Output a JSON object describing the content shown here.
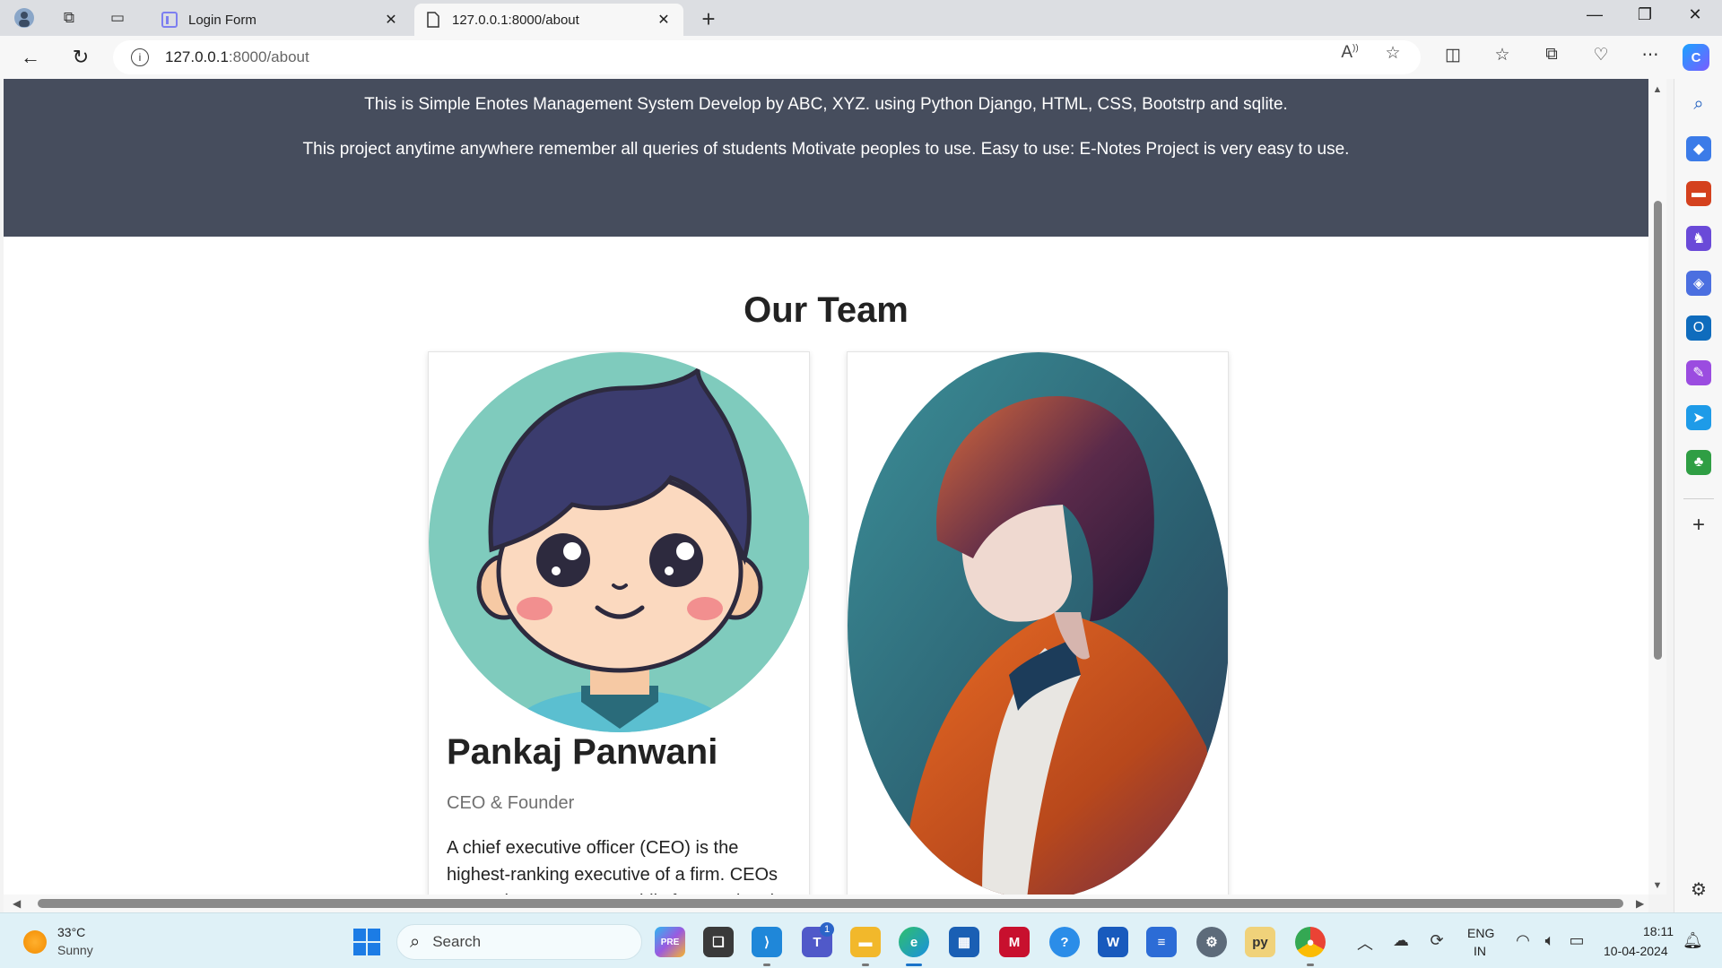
{
  "browser": {
    "tabs": [
      {
        "title": "Login Form",
        "active": false
      },
      {
        "title": "127.0.0.1:8000/about",
        "active": true
      }
    ],
    "url_host": "127.0.0.1",
    "url_path": ":8000/about"
  },
  "page": {
    "hero_line1": "This is Simple Enotes Management System Develop by ABC, XYZ. using Python Django, HTML, CSS, Bootstrp and sqlite.",
    "hero_line2": "This project anytime anywhere remember all queries of students Motivate peoples to use. Easy to use: E-Notes Project is very easy to use.",
    "team_title": "Our Team",
    "members": [
      {
        "name": "Pankaj Panwani",
        "role": "CEO & Founder",
        "bio": "A chief executive officer (CEO) is the highest-ranking executive of a firm. CEOs act as the company's public face and make"
      }
    ]
  },
  "taskbar": {
    "temperature": "33°C",
    "weather": "Sunny",
    "search_placeholder": "Search",
    "language_line1": "ENG",
    "language_line2": "IN",
    "time": "18:11",
    "date": "10-04-2024",
    "teams_badge": "1"
  },
  "colors": {
    "hero_bg": "#464d5d",
    "taskbar_bg": "#dff1f7",
    "accent": "#1a73c9"
  }
}
